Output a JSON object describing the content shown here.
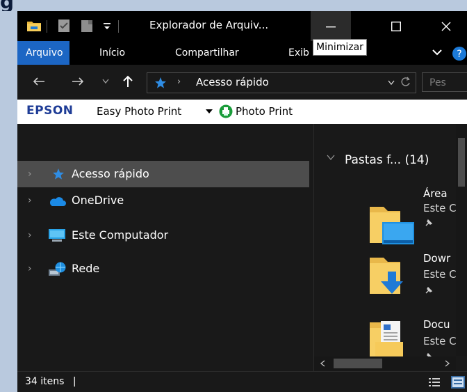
{
  "window": {
    "title": "Explorador de Arquiv...",
    "tooltip": "Minimizar"
  },
  "background": {
    "heading_fragment": "g"
  },
  "ribbon": {
    "tabs": [
      "Arquivo",
      "Início",
      "Compartilhar",
      "Exib"
    ]
  },
  "address": {
    "location": "Acesso rápido",
    "search_placeholder": "Pes"
  },
  "epson": {
    "logo": "EPSON",
    "easy_photo_print": "Easy Photo Print",
    "photo_print": "Photo Print"
  },
  "nav": {
    "items": [
      {
        "label": "Acesso rápido",
        "icon": "star-icon",
        "selected": true
      },
      {
        "label": "OneDrive",
        "icon": "cloud-icon"
      },
      {
        "label": "Este Computador",
        "icon": "monitor-icon"
      },
      {
        "label": "Rede",
        "icon": "network-icon"
      }
    ]
  },
  "content": {
    "section_title": "Pastas f... (14)",
    "tiles": [
      {
        "name": "Área",
        "sub": "Este C",
        "icon": "desktop-folder-icon"
      },
      {
        "name": "Dowr",
        "sub": "Este C",
        "icon": "downloads-folder-icon"
      },
      {
        "name": "Docu",
        "sub": "Este C",
        "icon": "documents-folder-icon"
      }
    ]
  },
  "status": {
    "item_count": "34 itens",
    "separator": "|"
  },
  "colors": {
    "accent": "#1c66c4",
    "selection": "#4d4d4d",
    "window_bg": "#191919",
    "titlebar_bg": "#000000",
    "desktop_bg": "#b9c9de"
  }
}
